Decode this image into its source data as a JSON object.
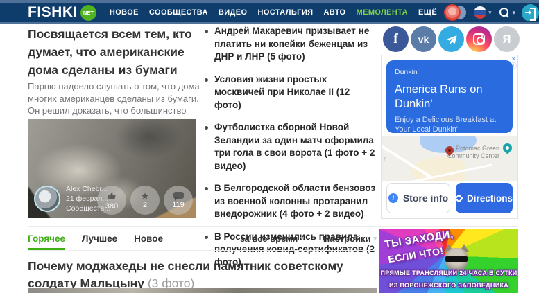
{
  "colors": {
    "header_bg": "#0e3d6c",
    "header_strip": "#4f7097",
    "logo_badge_green": "#4fb21e",
    "nav_highlight_green": "#7fd145",
    "tab_active_green": "#3fae14",
    "ad_blue": "#2a6cdf",
    "directions_blue": "#2f6ae3",
    "login_teal": "#2aa6c7"
  },
  "icons": {
    "caret": "▾",
    "star": "★",
    "close": "✕",
    "adchoices": "ⓘ"
  },
  "header": {
    "logo_text": "FISHKI",
    "logo_badge": "NET",
    "nav_items": [
      {
        "label": "НОВОЕ"
      },
      {
        "label": "СООБЩЕСТВА"
      },
      {
        "label": "ВИДЕО"
      },
      {
        "label": "НОСТАЛЬГИЯ"
      },
      {
        "label": "АВТО"
      },
      {
        "label": "МЕМОЛЕНТА"
      },
      {
        "label": "ЕЩЁ"
      }
    ]
  },
  "featured": {
    "title": "Посвящается всем тем, кто думает, что американские дома сделаны из бумаги",
    "excerpt": "Парню надоело слушать о том, что дома многих американцев сделаны из бумаги. Он решил доказать, что большинство",
    "author": "Alex Chebr...",
    "date": "21 феврал...",
    "community": "Сообществ...",
    "likes": "380",
    "stars": "2",
    "comments": "119"
  },
  "news": [
    {
      "text": "Андрей Макаревич призывает не платить ни копейки беженцам из ДНР и ЛНР (5 фото)"
    },
    {
      "text": "Условия жизни простых москвичей при Николае II (12 фото)"
    },
    {
      "text": "Футболистка сборной Новой Зеландии за один матч оформила три гола в свои ворота (1 фото + 2 видео)"
    },
    {
      "text": "В Белгородской области бензовоз из военной колонны протаранил внедорожник (4 фото + 2 видео)"
    },
    {
      "text": "В России изменились правила получения ковид-сертификатов (2 фото)"
    }
  ],
  "social_glyphs": {
    "facebook": "f",
    "vk": "vk",
    "yandex": "Я"
  },
  "ad": {
    "brand": "Dunkin'",
    "headline": "America Runs on Dunkin'",
    "body": "Enjoy a Delicious Breakfast at Your Local Dunkin'.",
    "map_label": "Potomac Green Community Center",
    "map_edge_label": "n",
    "store_info": "Store info",
    "directions": "Directions"
  },
  "promo": {
    "line1": "ТЫ ЗАХОДИ,",
    "line2": "ЕСЛИ ЧТО!",
    "line3": "ПРЯМЫЕ ТРАНСЛЯЦИИ 24 ЧАСА В СУТКИ",
    "line4": "ИЗ ВОРОНЕЖСКОГО ЗАПОВЕДНИКА"
  },
  "tabs": {
    "hot": "Горячее",
    "best": "Лучшее",
    "new": "Новое",
    "period": "за всё время",
    "settings": "Настройки"
  },
  "bottom_article": {
    "title": "Почему моджахеды не снесли памятник советскому солдату Мальцыну",
    "suffix": " (3 фото)"
  }
}
